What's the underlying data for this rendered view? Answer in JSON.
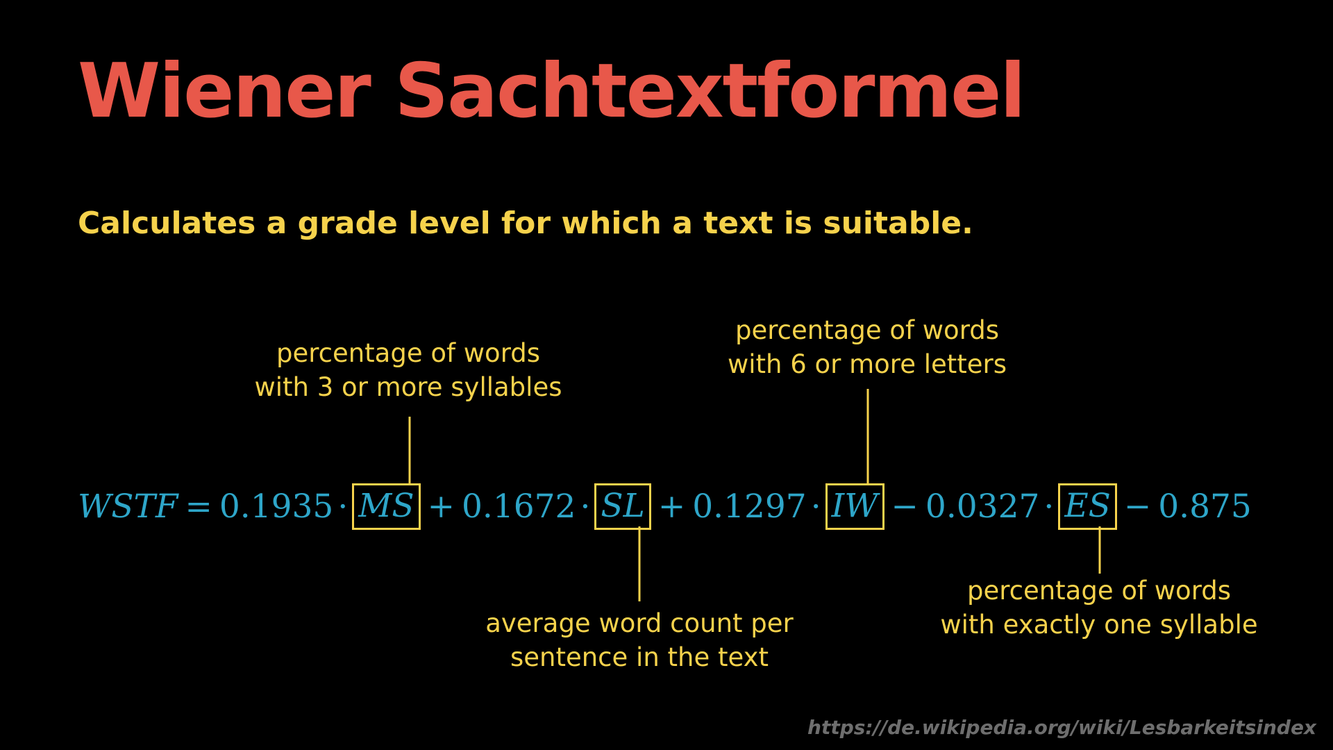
{
  "colors": {
    "background": "#000000",
    "title": "#e8584a",
    "annotation": "#f6d24c",
    "formula": "#2ea6c9",
    "source": "#6e6e6e"
  },
  "title": "Wiener Sachtextformel",
  "subtitle": "Calculates a grade level for which a text is suitable.",
  "formula": {
    "lhs": "WSTF",
    "equals": "=",
    "c1": "0.1935",
    "v1": "MS",
    "op2": "+",
    "c2": "0.1672",
    "v2": "SL",
    "op3": "+",
    "c3": "0.1297",
    "v3": "IW",
    "op4": "−",
    "c4": "0.0327",
    "v4": "ES",
    "op5": "−",
    "c5": "0.875",
    "dot": "·"
  },
  "annotations": {
    "ms": [
      "percentage of words",
      "with 3 or more syllables"
    ],
    "sl": [
      "average word count per",
      "sentence in the text"
    ],
    "iw": [
      "percentage of words",
      "with 6 or more letters"
    ],
    "es": [
      "percentage of words",
      "with exactly one syllable"
    ]
  },
  "source": "https://de.wikipedia.org/wiki/Lesbarkeitsindex"
}
